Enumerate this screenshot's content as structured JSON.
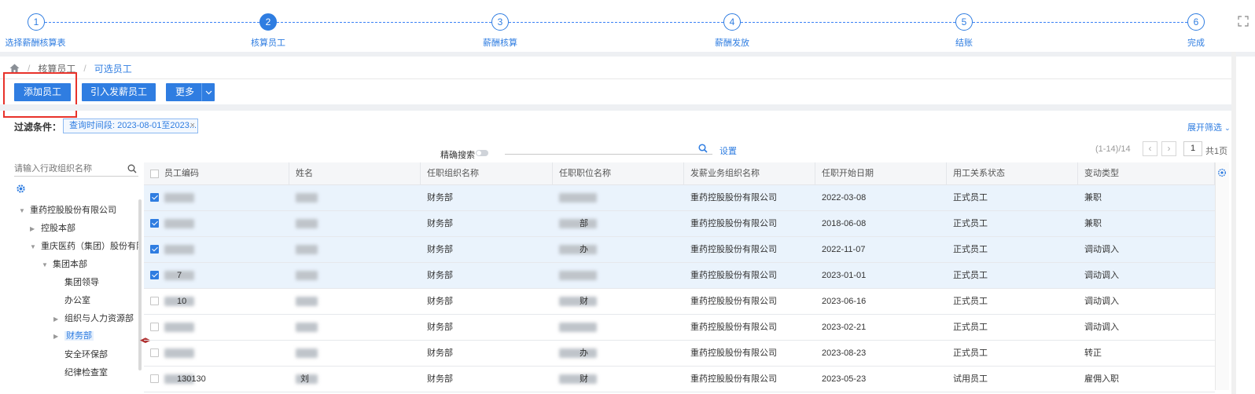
{
  "stepper": {
    "steps": [
      {
        "num": "1",
        "label": "选择薪酬核算表"
      },
      {
        "num": "2",
        "label": "核算员工"
      },
      {
        "num": "3",
        "label": "薪酬核算"
      },
      {
        "num": "4",
        "label": "薪酬发放"
      },
      {
        "num": "5",
        "label": "结账"
      },
      {
        "num": "6",
        "label": "完成"
      }
    ],
    "active_step": 2
  },
  "breadcrumb": {
    "home_icon": "home-icon",
    "items": [
      "核算员工",
      "可选员工"
    ]
  },
  "toolbar": {
    "add_label": "添加员工",
    "import_label": "引入发薪员工",
    "more_label": "更多"
  },
  "filter": {
    "label": "过滤条件：",
    "tag": "查询时间段: 2023-08-01至2023...",
    "expand": "展开筛选"
  },
  "search": {
    "exact_label": "精确搜索",
    "placeholder": "",
    "settings": "设置"
  },
  "pagination": {
    "info": "(1-14)/14",
    "current": "1",
    "total": "共1页"
  },
  "tree": {
    "search_placeholder": "请输入行政组织名称",
    "items": [
      {
        "label": "重药控股股份有限公司",
        "level": 0,
        "arrow": "down"
      },
      {
        "label": "控股本部",
        "level": 1,
        "arrow": "right"
      },
      {
        "label": "重庆医药（集团）股份有限公",
        "level": 1,
        "arrow": "down"
      },
      {
        "label": "集团本部",
        "level": 2,
        "arrow": "down"
      },
      {
        "label": "集团领导",
        "level": 3,
        "arrow": ""
      },
      {
        "label": "办公室",
        "level": 3,
        "arrow": ""
      },
      {
        "label": "组织与人力资源部",
        "level": 3,
        "arrow": "right"
      },
      {
        "label": "财务部",
        "level": 3,
        "arrow": "right",
        "selected": true
      },
      {
        "label": "安全环保部",
        "level": 3,
        "arrow": ""
      },
      {
        "label": "纪律检查室",
        "level": 3,
        "arrow": ""
      }
    ]
  },
  "table": {
    "columns": [
      "员工编码",
      "姓名",
      "任职组织名称",
      "任职职位名称",
      "发薪业务组织名称",
      "任职开始日期",
      "用工关系状态",
      "变动类型"
    ],
    "rows": [
      {
        "checked": true,
        "code": "",
        "name": "",
        "org": "财务部",
        "position": "",
        "pay_org": "重药控股股份有限公司",
        "start": "2022-03-08",
        "status": "正式员工",
        "change": "兼职"
      },
      {
        "checked": true,
        "code": "",
        "name": "",
        "org": "财务部",
        "position": "部",
        "pay_org": "重药控股股份有限公司",
        "start": "2018-06-08",
        "status": "正式员工",
        "change": "兼职"
      },
      {
        "checked": true,
        "code": "",
        "name": "",
        "org": "财务部",
        "position": "办",
        "pay_org": "重药控股股份有限公司",
        "start": "2022-11-07",
        "status": "正式员工",
        "change": "调动调入"
      },
      {
        "checked": true,
        "code": "7",
        "name": "",
        "org": "财务部",
        "position": "",
        "pay_org": "重药控股股份有限公司",
        "start": "2023-01-01",
        "status": "正式员工",
        "change": "调动调入"
      },
      {
        "checked": false,
        "code": "10",
        "name": "",
        "org": "财务部",
        "position": "财",
        "pay_org": "重药控股股份有限公司",
        "start": "2023-06-16",
        "status": "正式员工",
        "change": "调动调入"
      },
      {
        "checked": false,
        "code": "",
        "name": "",
        "org": "财务部",
        "position": "",
        "pay_org": "重药控股股份有限公司",
        "start": "2023-02-21",
        "status": "正式员工",
        "change": "调动调入"
      },
      {
        "checked": false,
        "code": "",
        "name": "",
        "org": "财务部",
        "position": "办",
        "pay_org": "重药控股股份有限公司",
        "start": "2023-08-23",
        "status": "正式员工",
        "change": "转正"
      },
      {
        "checked": false,
        "code": "130130",
        "name": "刘",
        "org": "财务部",
        "position": "财",
        "pay_org": "重药控股股份有限公司",
        "start": "2023-05-23",
        "status": "试用员工",
        "change": "雇佣入职"
      }
    ]
  },
  "colors": {
    "accent": "#2f7de1",
    "highlight_border": "#e8322a",
    "checked_row": "#eaf3fc"
  }
}
